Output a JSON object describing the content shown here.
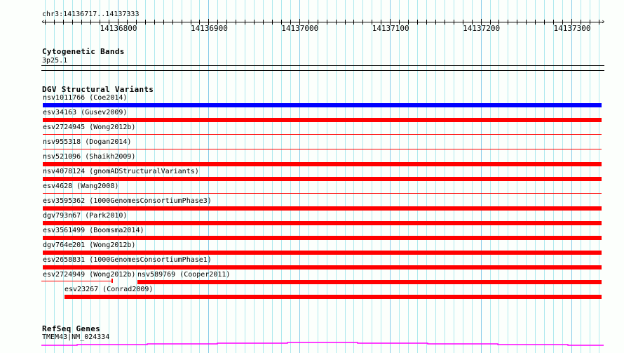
{
  "ruler": {
    "location": "chr3:14136717..14137333",
    "start": 14136717,
    "end": 14137333,
    "tick_labels": [
      "14136800",
      "14136900",
      "14137000",
      "14137100",
      "14137200",
      "14137300"
    ]
  },
  "cytobands": {
    "title": "Cytogenetic Bands",
    "band": "3p25.1"
  },
  "dgv": {
    "title": "DGV Structural Variants",
    "colors": {
      "blue": "#0000ff",
      "red": "#ff0000"
    },
    "variants": [
      {
        "label": "nsv1011766 (Coe2014)",
        "color": "#0000ff",
        "style": "thick",
        "start": 14136717,
        "end": 14137333,
        "row": 0
      },
      {
        "label": "esv34163 (Gusev2009)",
        "color": "#ff0000",
        "style": "thick",
        "start": 14136717,
        "end": 14137333,
        "row": 1
      },
      {
        "label": "esv2724945 (Wong2012b)",
        "color": "#ff0000",
        "style": "thin",
        "start": 14136717,
        "end": 14137333,
        "row": 2
      },
      {
        "label": "nsv955318 (Dogan2014)",
        "color": "#ff0000",
        "style": "thin",
        "start": 14136717,
        "end": 14137333,
        "row": 3
      },
      {
        "label": "nsv521096 (Shaikh2009)",
        "color": "#ff0000",
        "style": "thick",
        "start": 14136717,
        "end": 14137333,
        "row": 4
      },
      {
        "label": "nsv4078124 (gnomADStructuralVariants)",
        "color": "#ff0000",
        "style": "thick",
        "start": 14136717,
        "end": 14137333,
        "row": 5
      },
      {
        "label": "esv4628 (Wang2008)",
        "color": "#ff0000",
        "style": "thin",
        "start": 14136717,
        "end": 14137333,
        "row": 6
      },
      {
        "label": "esv3595362 (1000GenomesConsortiumPhase3)",
        "color": "#ff0000",
        "style": "thick",
        "start": 14136717,
        "end": 14137333,
        "row": 7
      },
      {
        "label": "dgv793n67 (Park2010)",
        "color": "#ff0000",
        "style": "thick",
        "start": 14136717,
        "end": 14137333,
        "row": 8
      },
      {
        "label": "esv3561499 (Boomsma2014)",
        "color": "#ff0000",
        "style": "thick",
        "start": 14136717,
        "end": 14137333,
        "row": 9
      },
      {
        "label": "dgv764e201 (Wong2012b)",
        "color": "#ff0000",
        "style": "thick",
        "start": 14136717,
        "end": 14137333,
        "row": 10
      },
      {
        "label": "esv2658831 (1000GenomesConsortiumPhase1)",
        "color": "#ff0000",
        "style": "thick",
        "start": 14136717,
        "end": 14137333,
        "row": 11
      },
      {
        "label": "esv2724949 (Wong2012b)",
        "color": "#ff0000",
        "style": "thin-end",
        "start": 14136717,
        "end": 14136794,
        "row": 12
      },
      {
        "label": "nsv589769 (Cooper2011)",
        "color": "#ff0000",
        "style": "thick",
        "start": 14136822,
        "end": 14137333,
        "row": 12
      },
      {
        "label": "esv23267 (Conrad2009)",
        "color": "#ff0000",
        "style": "thick",
        "start": 14136741,
        "end": 14137333,
        "row": 13
      }
    ]
  },
  "refseq": {
    "title": "RefSeq Genes",
    "gene": "TMEM43|NM_024334",
    "color": "#ff00ff"
  }
}
